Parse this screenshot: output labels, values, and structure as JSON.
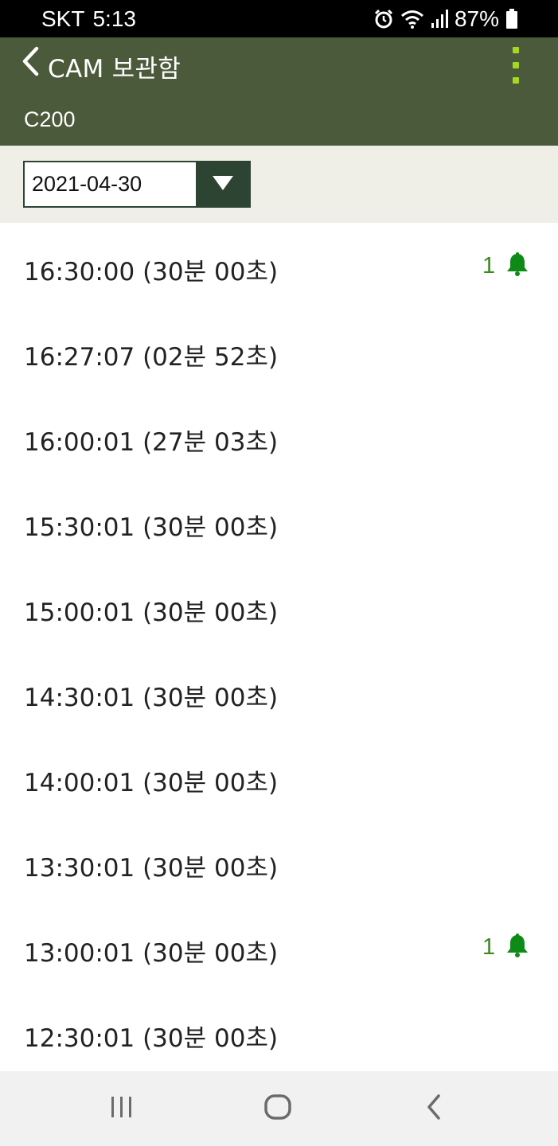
{
  "status_bar": {
    "carrier": "SKT",
    "time": "5:13",
    "battery": "87%",
    "icons": [
      "alarm-icon",
      "wifi-icon",
      "signal-icon",
      "battery-icon"
    ]
  },
  "app_bar": {
    "title": "CAM 보관함",
    "subtitle": "C200",
    "back_icon": "chevron-left-icon",
    "menu_icon": "kebab-menu-icon"
  },
  "date_filter": {
    "selected": "2021-04-30",
    "arrow_icon": "triangle-down-icon"
  },
  "recordings": [
    {
      "label": "16:30:00 (30분 00초)",
      "alert_count": "1"
    },
    {
      "label": "16:27:07 (02분 52초)",
      "alert_count": ""
    },
    {
      "label": "16:00:01 (27분 03초)",
      "alert_count": ""
    },
    {
      "label": "15:30:01 (30분 00초)",
      "alert_count": ""
    },
    {
      "label": "15:00:01 (30분 00초)",
      "alert_count": ""
    },
    {
      "label": "14:30:01 (30분 00초)",
      "alert_count": ""
    },
    {
      "label": "14:00:01 (30분 00초)",
      "alert_count": ""
    },
    {
      "label": "13:30:01 (30분 00초)",
      "alert_count": ""
    },
    {
      "label": "13:00:01 (30분 00초)",
      "alert_count": "1"
    },
    {
      "label": "12:30:01 (30분 00초)",
      "alert_count": ""
    }
  ],
  "colors": {
    "app_bar": "#4b5a3a",
    "date_bar": "#efefe7",
    "select_accent": "#2d4433",
    "kebab": "#a6d81e",
    "alert": "#3a8a1e"
  },
  "nav_bar": {
    "icons": [
      "recent-apps-icon",
      "home-icon",
      "back-icon"
    ]
  }
}
